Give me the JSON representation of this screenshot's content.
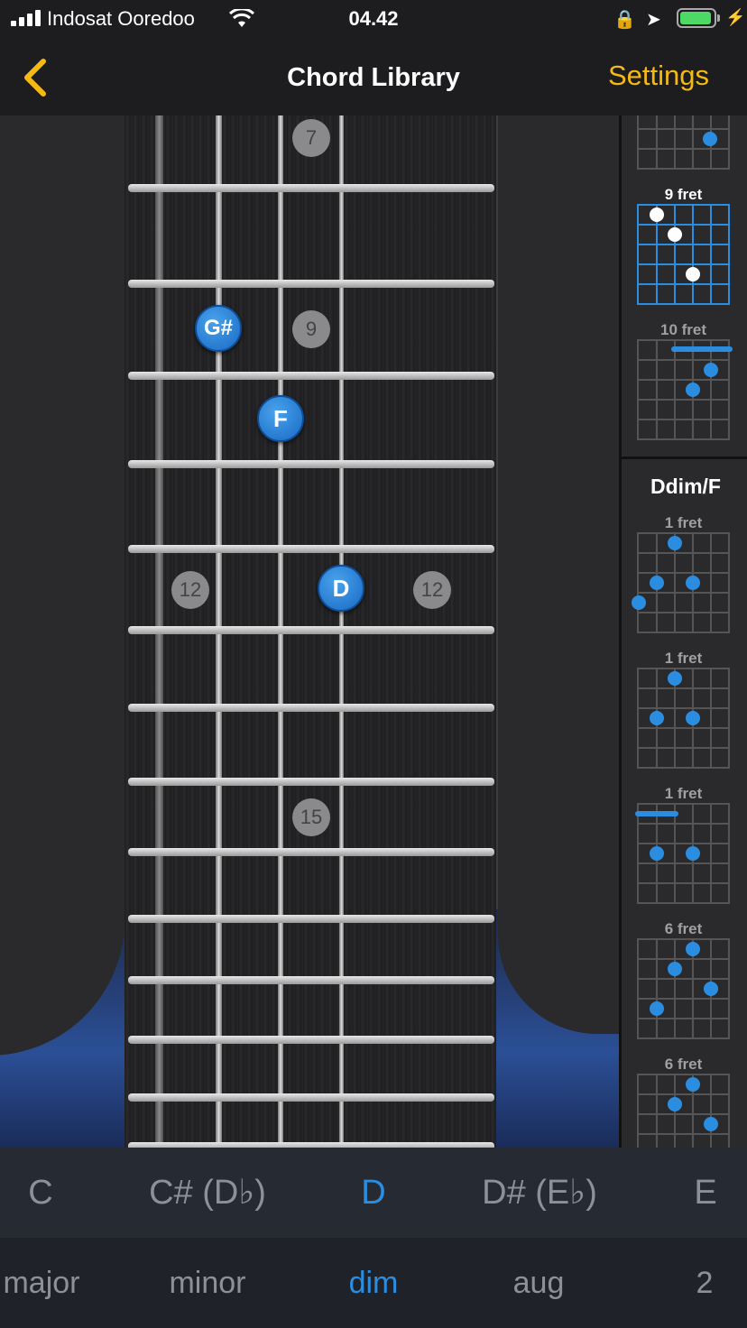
{
  "status": {
    "carrier": "Indosat Ooredoo",
    "time": "04.42"
  },
  "nav": {
    "back_icon": "chevron-left-icon",
    "title": "Chord Library",
    "settings": "Settings",
    "accent": "#f5b916"
  },
  "fretboard": {
    "markers": [
      "7",
      "9",
      "12",
      "12",
      "15"
    ],
    "notes": [
      "G#",
      "F",
      "D"
    ],
    "note_color": "#2a8de0"
  },
  "sidebar": {
    "prev_labels": [
      "9 fret",
      "10 fret"
    ],
    "chord_name": "Ddim/F",
    "labels": [
      "1 fret",
      "1 fret",
      "1 fret",
      "6 fret",
      "6 fret"
    ]
  },
  "keys": {
    "items": [
      "C",
      "C# (D♭)",
      "D",
      "D# (E♭)",
      "E"
    ],
    "selected": "D"
  },
  "types": {
    "items": [
      "major",
      "minor",
      "dim",
      "aug",
      "2"
    ],
    "selected": "dim"
  }
}
